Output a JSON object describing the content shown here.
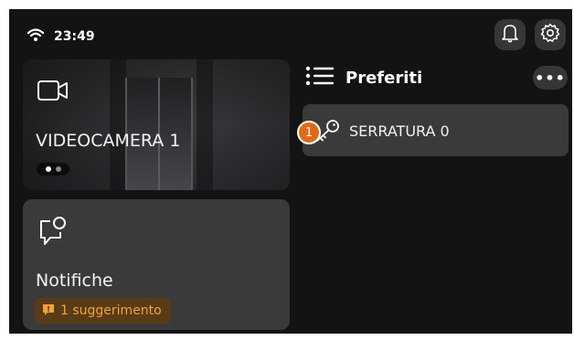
{
  "status_bar": {
    "time": "23:49",
    "wifi_icon": "wifi-icon"
  },
  "header_buttons": {
    "notifications_icon": "bell-icon",
    "settings_icon": "gear-icon"
  },
  "camera_card": {
    "label": "VIDEOCAMERA 1",
    "icon": "video-camera-icon",
    "page_count": 2,
    "active_page": 1
  },
  "notifications_card": {
    "label": "Notifiche",
    "icon": "chat-notification-icon",
    "badge_text": "1 suggerimento",
    "badge_icon": "alert-icon"
  },
  "favorites": {
    "title": "Preferiti",
    "icon": "list-icon",
    "more_label": "•••",
    "items": [
      {
        "label": "SERRATURA 0",
        "number": "1",
        "icon": "key-icon"
      }
    ]
  },
  "colors": {
    "background": "#131313",
    "card": "#3a3a3a",
    "accent_orange": "#e06a16",
    "badge_text": "#f3a23a"
  }
}
